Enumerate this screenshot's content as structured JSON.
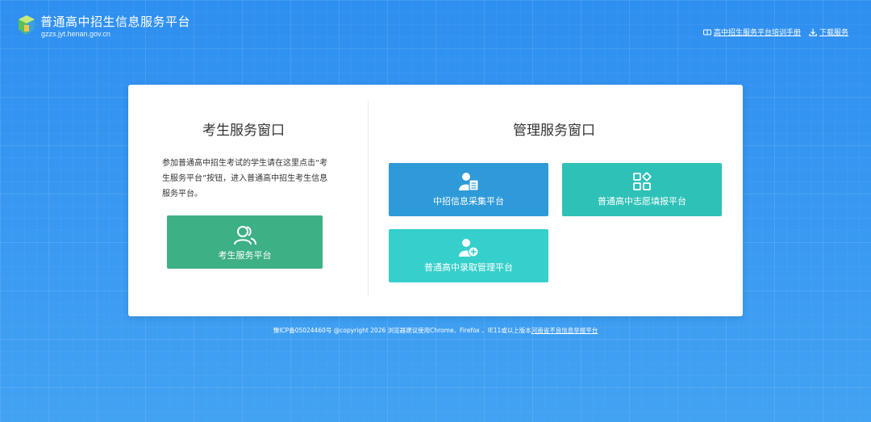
{
  "header": {
    "title": "普通高中招生信息服务平台",
    "domain": "gzzs.jyt.henan.gov.cn",
    "links": [
      {
        "label": "高中招生服务平台培训手册",
        "icon": "book-icon"
      },
      {
        "label": "下载服务",
        "icon": "download-icon"
      }
    ]
  },
  "student": {
    "title": "考生服务窗口",
    "description": "参加普通高中招生考试的学生请在这里点击“考生服务平台”按钮，进入普通高中招生考生信息服务平台。",
    "button": {
      "label": "考生服务平台",
      "icon": "users-icon",
      "color": "#3db085"
    }
  },
  "admin": {
    "title": "管理服务窗口",
    "buttons": [
      {
        "label": "中招信息采集平台",
        "icon": "user-form-icon",
        "color": "#2e9ad8"
      },
      {
        "label": "普通高中志愿填报平台",
        "icon": "apps-grid-icon",
        "color": "#2ec1b8"
      },
      {
        "label": "普通高中录取管理平台",
        "icon": "user-add-icon",
        "color": "#36d0cc"
      }
    ]
  },
  "footer": {
    "text": "豫ICP备05024460号 @copyright 2026 浏览器建议使用Chrome、Firefox 、IE11或以上版本",
    "link": "河南省不良信息举报平台"
  }
}
